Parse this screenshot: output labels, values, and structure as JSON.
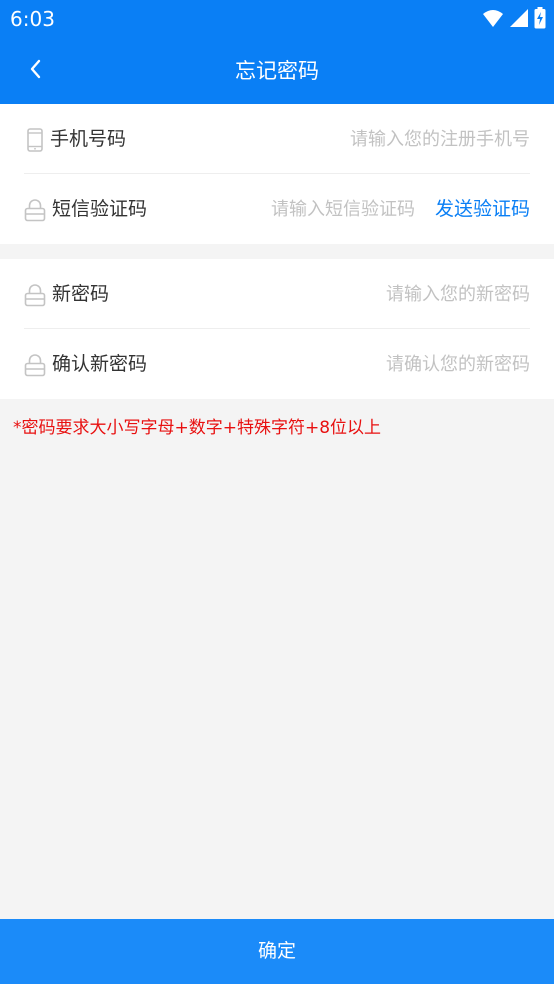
{
  "status_bar": {
    "time": "6:03",
    "icons": [
      "wifi-icon",
      "signal-icon",
      "battery-icon"
    ]
  },
  "nav": {
    "title": "忘记密码",
    "back_icon": "chevron-left-icon"
  },
  "phone_section": {
    "phone": {
      "label": "手机号码",
      "placeholder": "请输入您的注册手机号",
      "value": "",
      "icon": "phone-icon"
    },
    "sms_code": {
      "label": "短信验证码",
      "placeholder": "请输入短信验证码",
      "value": "",
      "icon": "lock-icon",
      "send_button_label": "发送验证码"
    }
  },
  "password_section": {
    "new_password": {
      "label": "新密码",
      "placeholder": "请输入您的新密码",
      "value": "",
      "icon": "lock-icon"
    },
    "confirm_password": {
      "label": "确认新密码",
      "placeholder": "请确认您的新密码",
      "value": "",
      "icon": "lock-icon"
    }
  },
  "hint": "*密码要求大小写字母+数字+特殊字符+8位以上",
  "confirm_button_label": "确定",
  "colors": {
    "primary": "#0a7ff5",
    "button": "#1b8bf9",
    "hint": "#e81010",
    "background": "#f4f4f4",
    "placeholder": "#c2c2c2"
  }
}
